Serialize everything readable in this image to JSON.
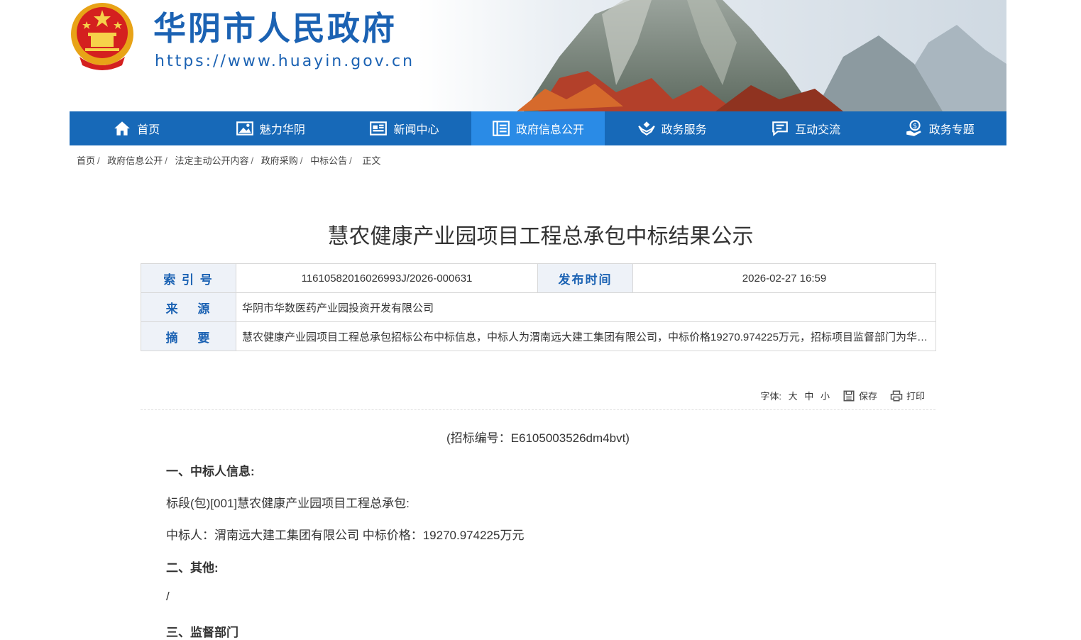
{
  "header": {
    "site_title": "华阴市人民政府",
    "site_url": "https://www.huayin.gov.cn"
  },
  "nav": {
    "items": [
      {
        "label": "首页",
        "icon": "home-icon"
      },
      {
        "label": "魅力华阴",
        "icon": "picture-icon"
      },
      {
        "label": "新闻中心",
        "icon": "newspaper-icon"
      },
      {
        "label": "政府信息公开",
        "icon": "document-list-icon",
        "active": true
      },
      {
        "label": "政务服务",
        "icon": "hands-service-icon"
      },
      {
        "label": "互动交流",
        "icon": "chat-icon"
      },
      {
        "label": "政务专题",
        "icon": "money-hand-icon"
      }
    ]
  },
  "breadcrumb": [
    "首页",
    "政府信息公开",
    "法定主动公开内容",
    "政府采购",
    "中标公告",
    "正文"
  ],
  "article": {
    "title": "慧农健康产业园项目工程总承包中标结果公示",
    "meta": {
      "index_label": "索 引 号",
      "index_value": "11610582016026993J/2026-000631",
      "date_label": "发布时间",
      "date_value": "2026-02-27 16:59",
      "source_label": "来　 源",
      "source_value": "华阴市华数医药产业园投资开发有限公司",
      "summary_label": "摘　 要",
      "summary_value": "慧农健康产业园项目工程总承包招标公布中标信息，中标人为渭南远大建工集团有限公司，中标价格19270.974225万元，招标项目监督部门为华阴市住房和城乡建设局。"
    },
    "tools": {
      "font_label": "字体:",
      "font_large": "大",
      "font_medium": "中",
      "font_small": "小",
      "save": "保存",
      "print": "打印"
    },
    "body": {
      "bid_number": "(招标编号：E6105003526dm4bvt)",
      "section1": "一、中标人信息:",
      "lot": "标段(包)[001]慧农健康产业园项目工程总承包:",
      "winner": "中标人：渭南远大建工集团有限公司 中标价格：19270.974225万元",
      "section2": "二、其他:",
      "other": "/",
      "section3": "三、监督部门"
    }
  },
  "colors": {
    "brand_blue": "#1769b8",
    "nav_active": "#2a8be6",
    "label_blue": "#1b62b3"
  }
}
